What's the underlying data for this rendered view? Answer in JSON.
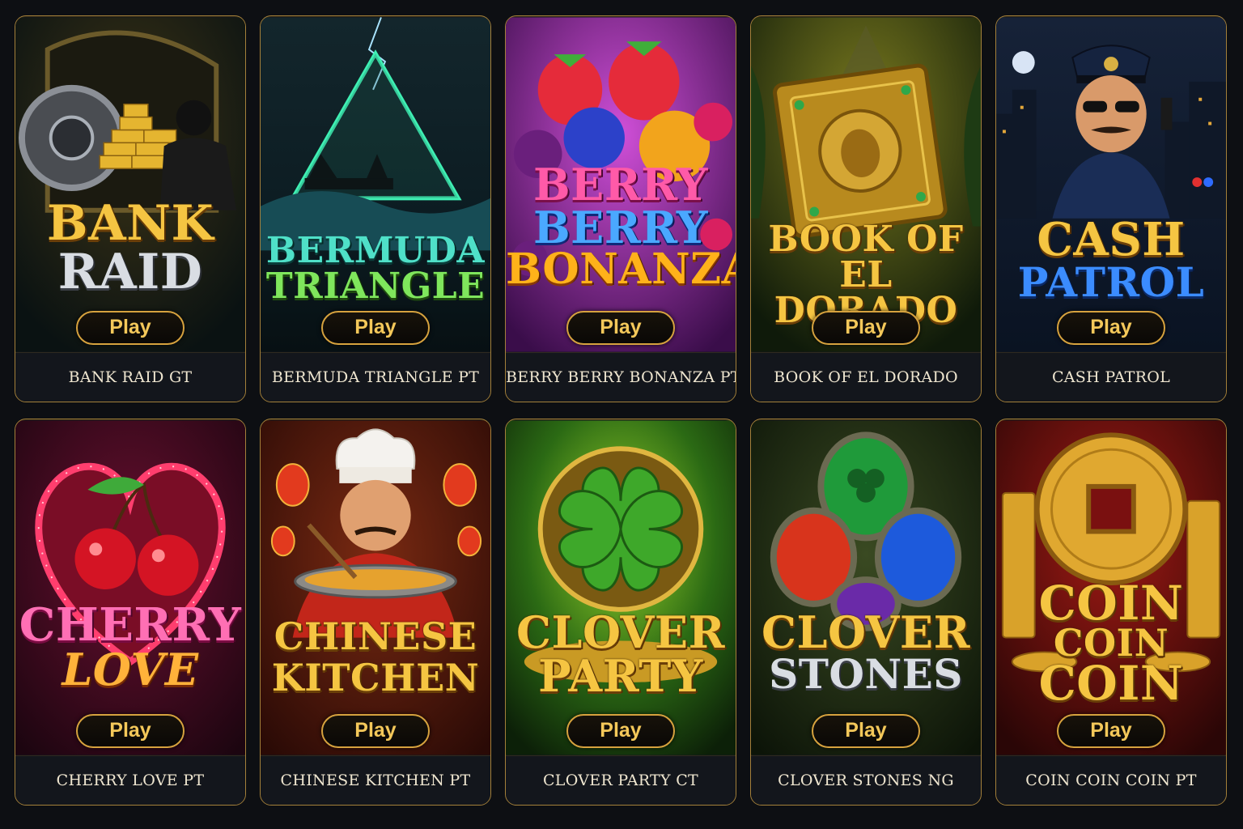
{
  "play_label": "Play",
  "games": [
    {
      "caption": "BANK RAID GT",
      "logo_lines": [
        "BANK",
        "RAID"
      ],
      "theme": "vault-gold",
      "icon": "vault-robber-icon"
    },
    {
      "caption": "BERMUDA TRIANGLE PT",
      "logo_lines": [
        "BERMUDA",
        "TRIANGLE"
      ],
      "theme": "stormy-sea",
      "icon": "triangle-ship-icon"
    },
    {
      "caption": "BERRY BERRY BONANZA PT",
      "logo_lines": [
        "BERRY",
        "BERRY",
        "BONANZA"
      ],
      "theme": "purple-berries",
      "icon": "berries-icon"
    },
    {
      "caption": "BOOK OF EL DORADO",
      "logo_lines": [
        "BOOK OF",
        "EL DORADO"
      ],
      "theme": "jungle-gold",
      "icon": "golden-book-icon"
    },
    {
      "caption": "CASH PATROL",
      "logo_lines": [
        "CASH",
        "PATROL"
      ],
      "theme": "night-city",
      "icon": "police-officer-icon"
    },
    {
      "caption": "CHERRY LOVE PT",
      "logo_lines": [
        "CHERRY",
        "LOVE"
      ],
      "theme": "neon-heart",
      "icon": "cherries-icon"
    },
    {
      "caption": "CHINESE KITCHEN PT",
      "logo_lines": [
        "CHINESE",
        "KITCHEN"
      ],
      "theme": "red-lanterns",
      "icon": "chef-icon"
    },
    {
      "caption": "CLOVER PARTY CT",
      "logo_lines": [
        "CLOVER",
        "PARTY"
      ],
      "theme": "green-glow",
      "icon": "four-leaf-clover-icon"
    },
    {
      "caption": "CLOVER STONES NG",
      "logo_lines": [
        "CLOVER",
        "STONES"
      ],
      "theme": "forest-stones",
      "icon": "clover-gems-icon"
    },
    {
      "caption": "COIN COIN COIN PT",
      "logo_lines": [
        "COIN",
        "COIN",
        "COIN"
      ],
      "theme": "red-curtain-gold",
      "icon": "gold-coin-icon"
    }
  ]
}
